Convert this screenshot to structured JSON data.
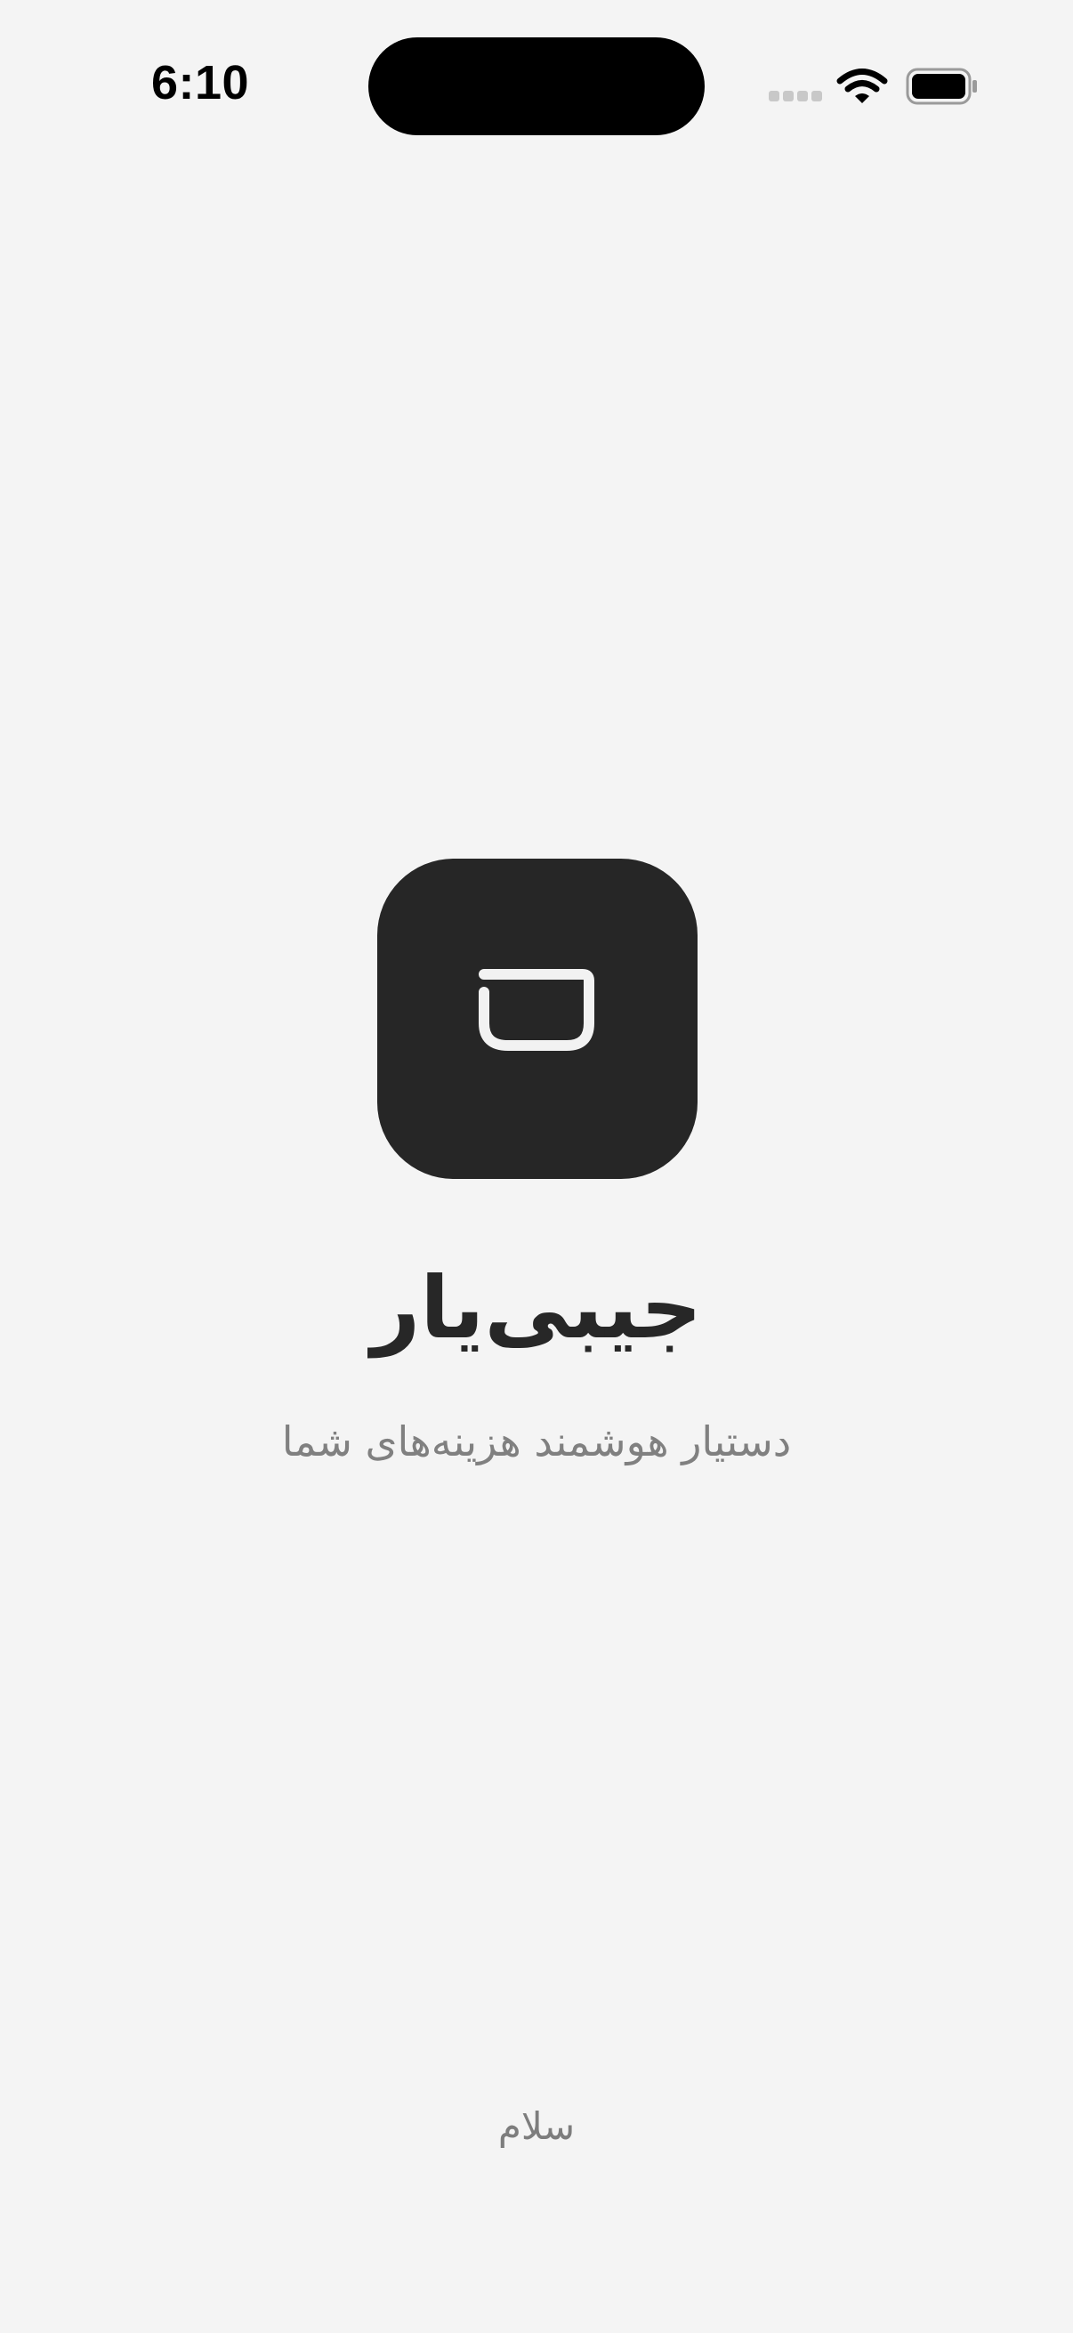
{
  "status_bar": {
    "time": "6:10",
    "icons": [
      "cellular-signal-icon",
      "wifi-icon",
      "battery-icon"
    ]
  },
  "splash": {
    "logo_icon": "pocket-icon",
    "app_name": "جیبی‌یار",
    "tagline": "دستیار هوشمند هزینه‌های شما",
    "footer_text": "سلام"
  },
  "colors": {
    "background": "#f4f4f4",
    "logo_background": "#262626",
    "logo_glyph": "#f2f2f2",
    "title_text": "#272727",
    "secondary_text": "#808080"
  }
}
